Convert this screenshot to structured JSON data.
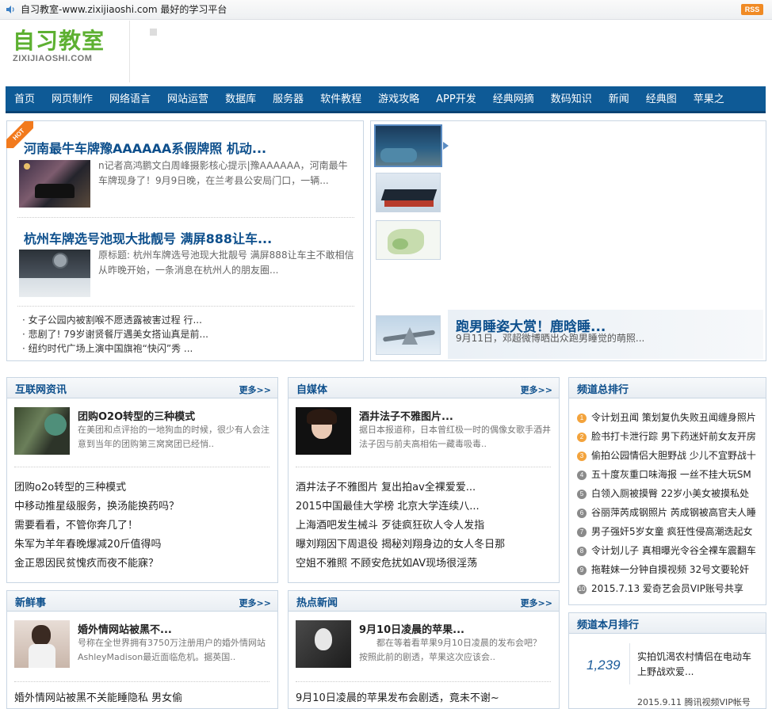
{
  "topbar": {
    "site_text": "自习教室-www.zixijiaoshi.com 最好的学习平台",
    "rss_label": "RSS"
  },
  "logo": {
    "cn": "自习教室",
    "en": "ZIXIJIAOSHI.COM"
  },
  "nav": {
    "items": [
      "首页",
      "网页制作",
      "网络语言",
      "网站运营",
      "数据库",
      "服务器",
      "软件教程",
      "游戏攻略",
      "APP开发",
      "经典网摘",
      "数码知识",
      "新闻",
      "经典图",
      "苹果之"
    ]
  },
  "hot_badge": "HOT",
  "headline": {
    "story1": {
      "title": "河南最牛车牌豫AAAAAA系假牌照 机动...",
      "summary": "n记者高鸿鹏文白周峰摄影核心提示|豫AAAAAA，河南最牛车牌现身了！9月9日晚，在兰考县公安局门口，一辆..."
    },
    "story2": {
      "title": "杭州车牌选号池现大批靓号 满屏888让车...",
      "summary": "原标题: 杭州车牌选号池现大批靓号 满屏888让车主不敢相信　　从昨晚开始，一条消息在杭州人的朋友圈..."
    },
    "list": [
      "· 女子公园内被割喉不愿透露被害过程 行...",
      "· 悲剧了! 79岁谢贤餐厅遇美女搭讪真是前...",
      "· 纽约时代广场上演中国旗袍“快闪”秀 ..."
    ]
  },
  "slideshow": {
    "caption_title": "跑男睡姿大赏！鹿晗睡...",
    "caption_desc": "9月11日，邓超微博晒出众跑男睡觉的萌照..."
  },
  "internet": {
    "title": "互联网资讯",
    "more": "更多>>",
    "feature_title": "团购O2O转型的三种模式",
    "feature_desc": "在美团和点评抬的一地狗血的时候，很少有人会注意到当年的团购第三窝窝团已经悄..",
    "list": [
      "团购o2o转型的三种模式",
      "中移动推星级服务，换汤能换药吗？",
      "需要看看，不管你奔几了！",
      "朱军为羊年春晚爆减20斤值得吗",
      "金正恩因民贫愧疚而夜不能寐？"
    ]
  },
  "selfmedia": {
    "title": "自媒体",
    "more": "更多>>",
    "feature_title": "酒井法子不雅图片...",
    "feature_desc": "据日本报道称，日本曾红极一时的偶像女歌手酒井法子因与前夫高相佑一藏毒吸毒..",
    "list": [
      "酒井法子不雅图片 复出拍av全裸爱爱...",
      "2015中国最佳大学榜 北京大学连续八...",
      "上海酒吧发生械斗 歹徒疯狂砍人令人发指",
      "曝刘翔因下周退役 揭秘刘翔身边的女人冬日那",
      "空姐不雅照 不顾安危扰如AV现场很淫荡"
    ]
  },
  "ranking": {
    "title": "频道总排行",
    "items": [
      {
        "num": "1",
        "text": "令计划丑闻 策划复仇失败丑闻缠身照片"
      },
      {
        "num": "2",
        "text": "脸书打卡泄行踪 男下药迷奸前女友开房"
      },
      {
        "num": "3",
        "text": "偷拍公园情侣大胆野战 少儿不宜野战十"
      },
      {
        "num": "4",
        "text": "五十度灰重口味海报 一丝不挂大玩SM"
      },
      {
        "num": "5",
        "text": "白领入厕被摸臀 22岁小美女被摸私处"
      },
      {
        "num": "6",
        "text": "谷丽萍芮成钢照片 芮成钢被高官夫人睡"
      },
      {
        "num": "7",
        "text": "男子强奸5岁女童 疯狂性侵高潮迭起女"
      },
      {
        "num": "8",
        "text": "令计划儿子 真相曝光令谷全裸车震翻车"
      },
      {
        "num": "9",
        "text": "拖鞋妹一分钟自摸视频 32号文要轮奸"
      },
      {
        "num": "10",
        "text": "2015.7.13 爱奇艺会员VIP账号共享"
      }
    ]
  },
  "fresh": {
    "title": "新鲜事",
    "more": "更多>>",
    "feature_title": "婚外情网站被黑不...",
    "feature_desc": "号称在全世界拥有3750万注册用户的婚外情网站AshleyMadison最近面临危机。据英国..",
    "list_partial": "婚外情网站被黑不关能睡隐私 男女偷"
  },
  "hotnews": {
    "title": "热点新闻",
    "more": "更多>>",
    "feature_title": "9月10日凌晨的苹果...",
    "feature_desc": "　　都在等着看苹果9月10日凌晨的发布会吧？　　按照此前的剧透，苹果这次应该会..",
    "list_partial": "9月10日凌晨的苹果发布会剧透，竟未不谢~"
  },
  "monthly": {
    "title": "频道本月排行",
    "count": "1,239",
    "item_text": "实拍饥渴农村情侣在电动车上野战欢爱...",
    "next_partial": "2015.9.11 腾讯视频VIP帐号"
  },
  "colors": {
    "nav_bg": "#0e5a96",
    "link_blue": "#0d4f8c",
    "logo_green": "#5db031",
    "rss_orange": "#f08a24",
    "rank_top": "#f3a33c",
    "rank_rest": "#8a8a8a"
  }
}
